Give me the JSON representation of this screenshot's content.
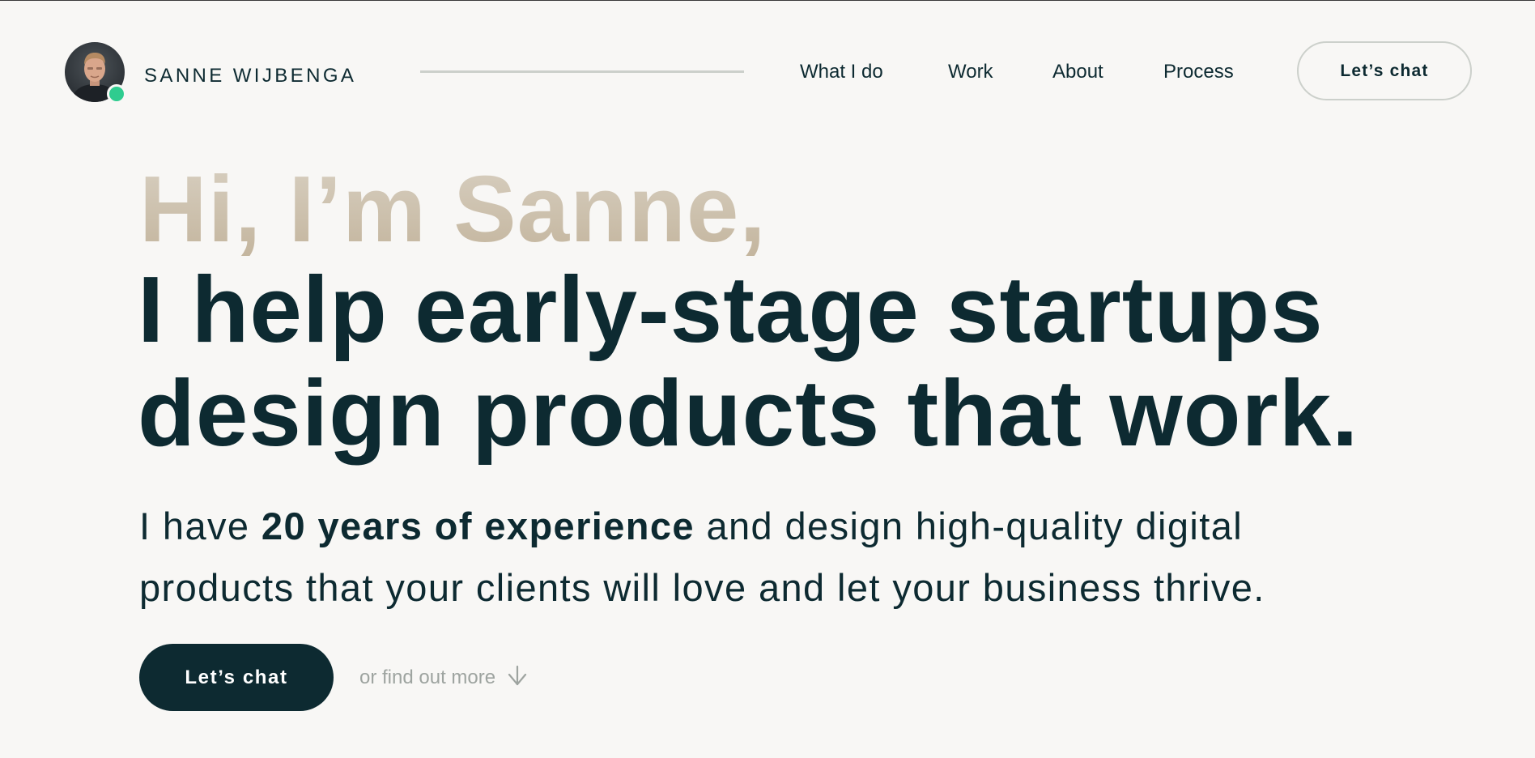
{
  "brand": {
    "name": "SANNE WIJBENGA",
    "status_color": "#2fcc8f"
  },
  "nav": {
    "items": [
      {
        "label": "What I do"
      },
      {
        "label": "Work"
      },
      {
        "label": "About"
      },
      {
        "label": "Process"
      }
    ],
    "cta_label": "Let’s chat"
  },
  "hero": {
    "greeting": "Hi, I’m Sanne,",
    "headline_line1": "I help early-stage startups",
    "headline_line2": "design products that work.",
    "sub_prefix": "I have ",
    "sub_bold": "20 years of experience",
    "sub_suffix": " and design high-quality digital",
    "sub_line2": "products that your clients will love and let your business thrive.",
    "cta_label": "Let’s chat",
    "find_more_label": "or find out more",
    "find_more_icon": "arrow-down-icon"
  },
  "colors": {
    "background": "#f8f7f5",
    "primary": "#0d2a31",
    "greeting_accent": "#c2b39b",
    "muted": "#9ea4a0"
  }
}
